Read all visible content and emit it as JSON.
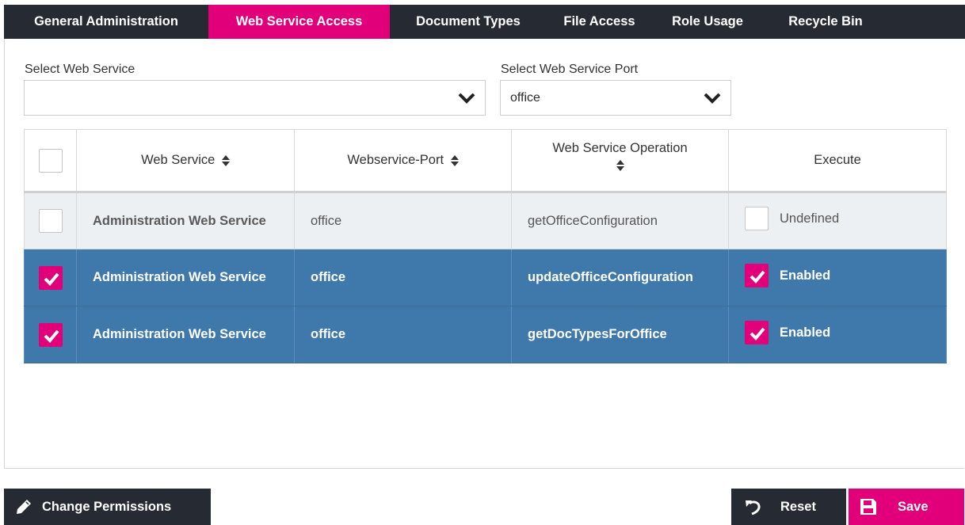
{
  "tabs": [
    {
      "label": "General Administration",
      "active": false
    },
    {
      "label": "Web Service Access",
      "active": true
    },
    {
      "label": "Document Types",
      "active": false
    },
    {
      "label": "File Access",
      "active": false
    },
    {
      "label": "Role Usage",
      "active": false
    },
    {
      "label": "Recycle Bin",
      "active": false
    }
  ],
  "filters": {
    "web_service": {
      "label": "Select Web Service",
      "value": ""
    },
    "web_service_port": {
      "label": "Select Web Service Port",
      "value": "office"
    }
  },
  "table": {
    "headers": {
      "web_service": "Web Service",
      "port": "Webservice-Port",
      "operation": "Web Service Operation",
      "execute": "Execute"
    },
    "rows": [
      {
        "service": "Administration Web Service",
        "port": "office",
        "operation": "getOfficeConfiguration",
        "execute": "Undefined",
        "selected": false
      },
      {
        "service": "Administration Web Service",
        "port": "office",
        "operation": "updateOfficeConfiguration",
        "execute": "Enabled",
        "selected": true
      },
      {
        "service": "Administration Web Service",
        "port": "office",
        "operation": "getDocTypesForOffice",
        "execute": "Enabled",
        "selected": true
      }
    ]
  },
  "actions": {
    "change_permissions": "Change Permissions",
    "reset": "Reset",
    "save": "Save"
  },
  "colors": {
    "accent": "#e2007a",
    "dark": "#262a33",
    "selected_row": "#3f79ac"
  }
}
